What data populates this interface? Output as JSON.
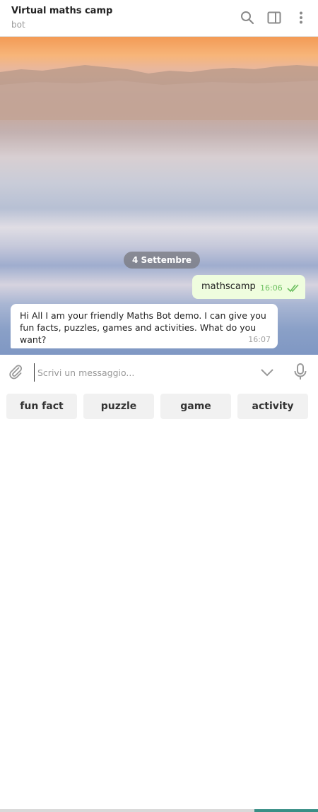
{
  "header": {
    "title": "Virtual maths camp",
    "subtitle": "bot",
    "icons": [
      "search-icon",
      "sidebar-toggle-icon",
      "more-vertical-icon"
    ]
  },
  "chat": {
    "date_label": "4 Settembre",
    "messages": [
      {
        "direction": "outgoing",
        "text": "mathscamp",
        "time": "16:06",
        "status": "read"
      },
      {
        "direction": "incoming",
        "text": "Hi All I am your friendly Maths Bot demo. I can give you fun facts, puzzles, games and activities. What do you want?",
        "time": "16:07"
      }
    ]
  },
  "composer": {
    "placeholder": "Scrivi un messaggio...",
    "value": ""
  },
  "keyboard": {
    "buttons": [
      "fun fact",
      "puzzle",
      "game",
      "activity"
    ]
  },
  "colors": {
    "outgoing_bubble": "#effdde",
    "incoming_bubble": "#ffffff",
    "read_ticks": "#6cbf5f"
  }
}
